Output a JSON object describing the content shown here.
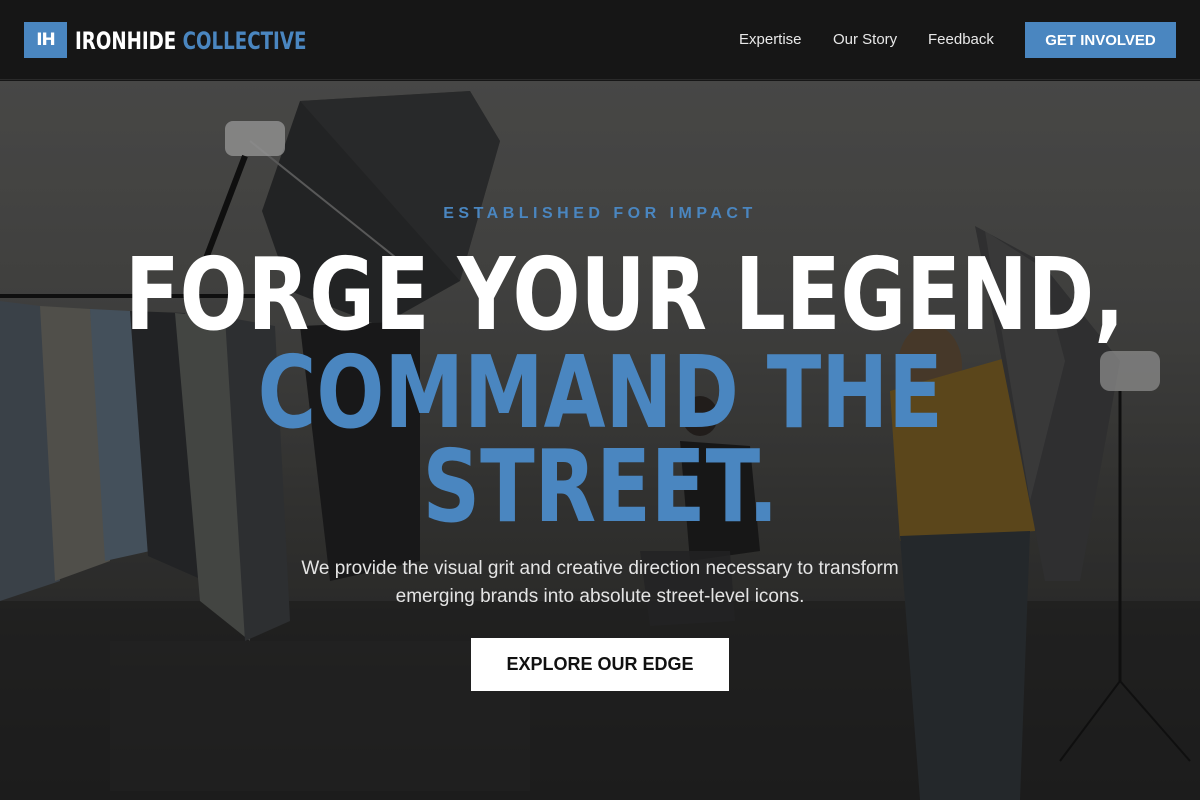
{
  "brand": {
    "mark": "IH",
    "name_primary": "IRONHIDE",
    "name_accent": "COLLECTIVE",
    "accent_color": "#4a86c0"
  },
  "nav": {
    "links": [
      "Expertise",
      "Our Story",
      "Feedback"
    ],
    "cta_label": "GET INVOLVED"
  },
  "hero": {
    "eyebrow": "ESTABLISHED FOR IMPACT",
    "headline_line1": "FORGE YOUR LEGEND,",
    "headline_line2": "COMMAND THE",
    "headline_line3": "STREET.",
    "subtext": "We provide the visual grit and creative direction necessary to transform emerging brands into absolute street-level icons.",
    "button_label": "EXPLORE OUR EDGE",
    "background_description_icon": "photo-studio-background"
  }
}
